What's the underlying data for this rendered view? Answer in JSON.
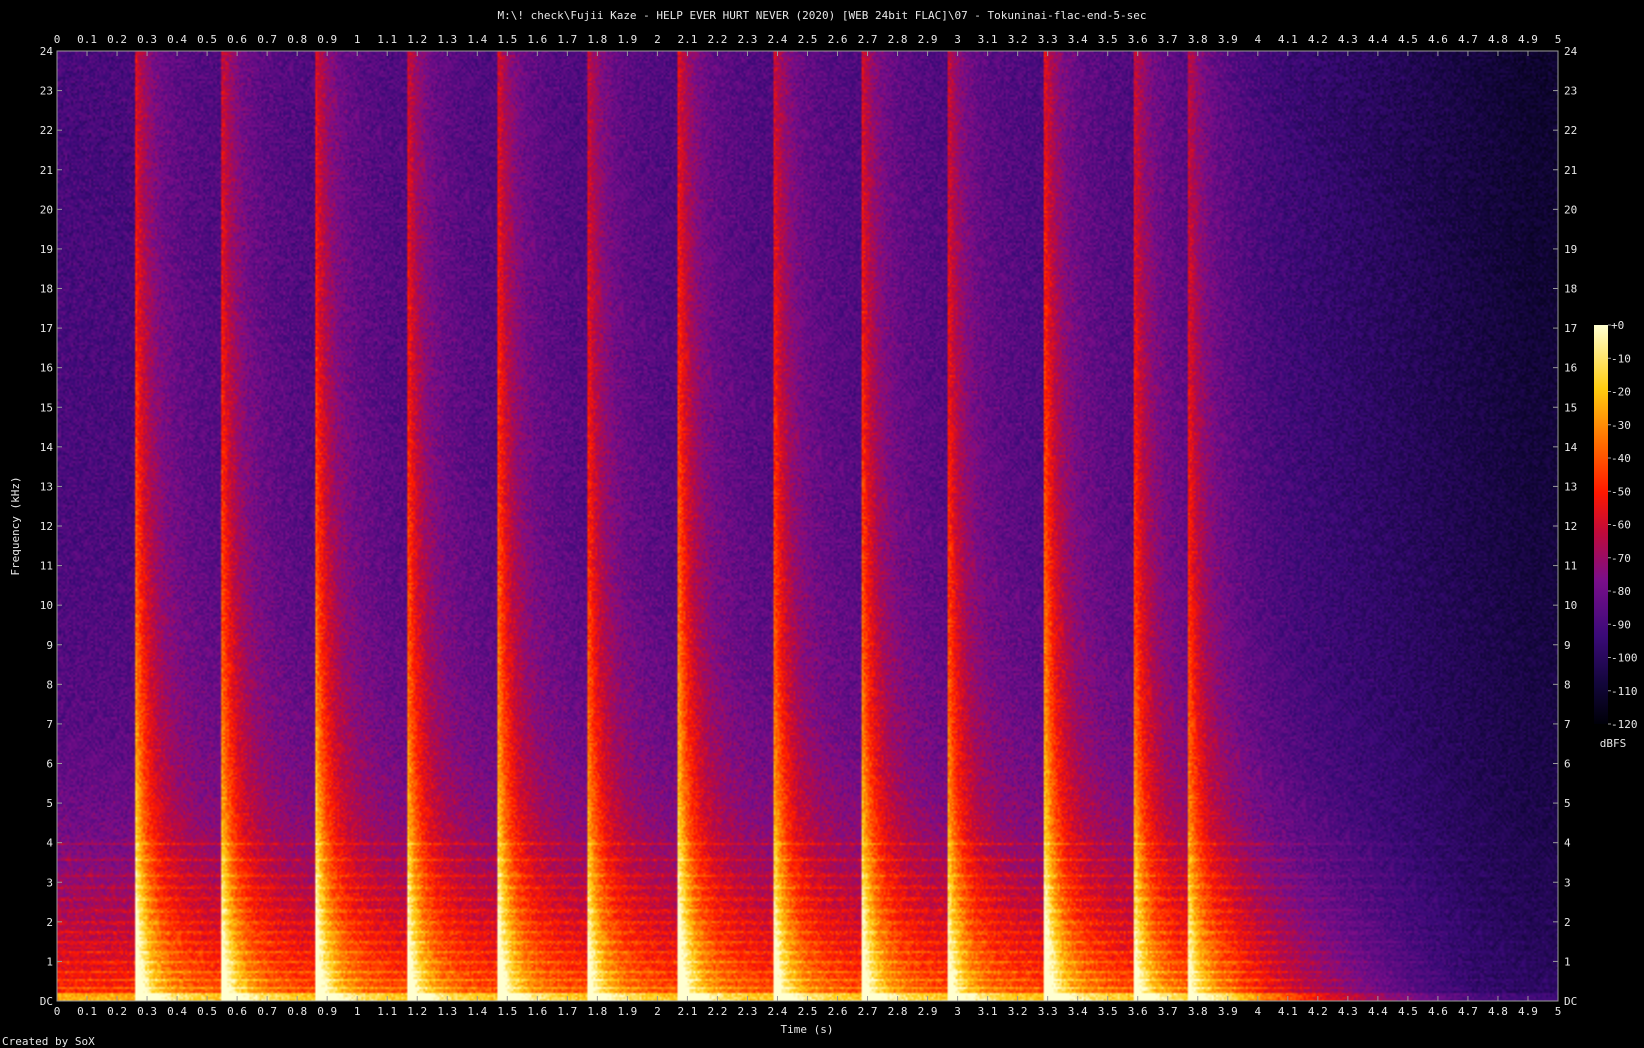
{
  "header": {
    "title": "M:\\! check\\Fujii Kaze - HELP EVER HURT NEVER (2020) [WEB 24bit FLAC]\\07 - Tokuninai-flac-end-5-sec"
  },
  "footer": {
    "credit": "Created by SoX"
  },
  "colors": {
    "background": "#000000",
    "frame": "#9a9a9a",
    "text": "#e8e8e8",
    "palette": [
      "#000008",
      "#12063a",
      "#3a0a78",
      "#7a0e8a",
      "#c00a3a",
      "#ff1800",
      "#ff6a00",
      "#ffcc10",
      "#ffffd0"
    ]
  },
  "chart_data": {
    "type": "heatmap",
    "title": "M:\\! check\\Fujii Kaze - HELP EVER HURT NEVER (2020) [WEB 24bit FLAC]\\07 - Tokuninai-flac-end-5-sec",
    "xlabel": "Time (s)",
    "ylabel": "Frequency (kHz)",
    "xlim": [
      0,
      5
    ],
    "ylim": [
      0,
      24
    ],
    "x_ticks": [
      "0",
      "0.1",
      "0.2",
      "0.3",
      "0.4",
      "0.5",
      "0.6",
      "0.7",
      "0.8",
      "0.9",
      "1",
      "1.1",
      "1.2",
      "1.3",
      "1.4",
      "1.5",
      "1.6",
      "1.7",
      "1.8",
      "1.9",
      "2",
      "2.1",
      "2.2",
      "2.3",
      "2.4",
      "2.5",
      "2.6",
      "2.7",
      "2.8",
      "2.9",
      "3",
      "3.1",
      "3.2",
      "3.3",
      "3.4",
      "3.5",
      "3.6",
      "3.7",
      "3.8",
      "3.9",
      "4",
      "4.1",
      "4.2",
      "4.3",
      "4.4",
      "4.5",
      "4.6",
      "4.7",
      "4.8",
      "4.9",
      "5"
    ],
    "y_ticks": [
      "DC",
      "1",
      "2",
      "3",
      "4",
      "5",
      "6",
      "7",
      "8",
      "9",
      "10",
      "11",
      "12",
      "13",
      "14",
      "15",
      "16",
      "17",
      "18",
      "19",
      "20",
      "21",
      "22",
      "23",
      "24"
    ],
    "colorbar": {
      "label": "dBFS",
      "ticks": [
        "+0",
        "-10",
        "-20",
        "-30",
        "-40",
        "-50",
        "-60",
        "-70",
        "-80",
        "-90",
        "-100",
        "-110",
        "-120"
      ],
      "range": [
        -120,
        0
      ]
    },
    "onsets": [
      {
        "t": 0.26,
        "top_khz": 24,
        "strength": 1.0
      },
      {
        "t": 0.55,
        "top_khz": 24,
        "strength": 0.9
      },
      {
        "t": 0.86,
        "top_khz": 24,
        "strength": 1.0
      },
      {
        "t": 1.17,
        "top_khz": 24,
        "strength": 0.9
      },
      {
        "t": 1.47,
        "top_khz": 24,
        "strength": 0.95
      },
      {
        "t": 1.77,
        "top_khz": 24,
        "strength": 0.85
      },
      {
        "t": 2.07,
        "top_khz": 24,
        "strength": 1.0
      },
      {
        "t": 2.39,
        "top_khz": 24,
        "strength": 0.9
      },
      {
        "t": 2.68,
        "top_khz": 24,
        "strength": 0.95
      },
      {
        "t": 2.97,
        "top_khz": 24,
        "strength": 0.85
      },
      {
        "t": 3.29,
        "top_khz": 24,
        "strength": 1.0
      },
      {
        "t": 3.59,
        "top_khz": 24,
        "strength": 0.85
      },
      {
        "t": 3.77,
        "top_khz": 24,
        "strength": 0.8
      }
    ],
    "fade_start_s": 3.9,
    "fade_end_s": 4.9
  }
}
